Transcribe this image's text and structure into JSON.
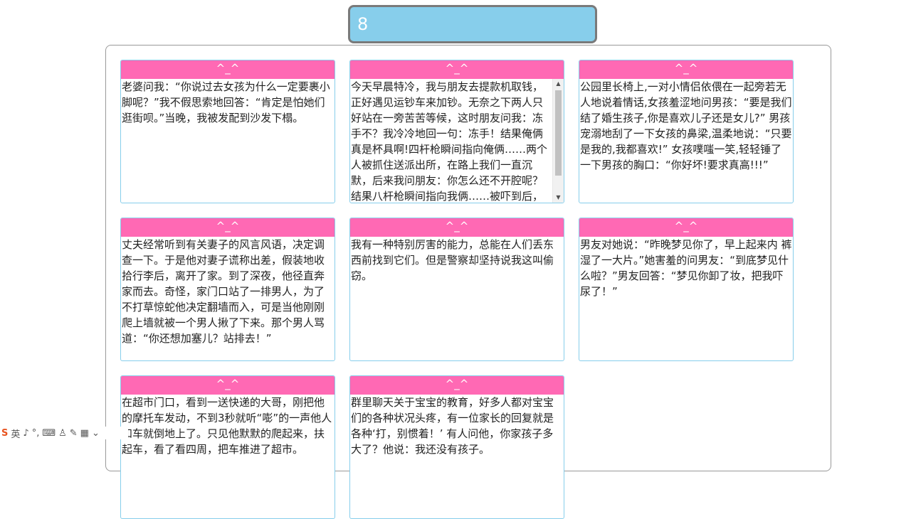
{
  "counter": {
    "value": "8"
  },
  "cards": [
    {
      "header": "^_^",
      "text": "老婆问我：“你说过去女孩为什么一定要裹小脚呢？”我不假思索地回答：“肯定是怕她们逛街呗。”当晚，我被发配到沙发下榻。"
    },
    {
      "header": "^_^",
      "text": "今天早晨特冷，我与朋友去提款机取钱，正好遇见运钞车来加钞。无奈之下两人只好站在一旁苦苦等候，这时朋友问我：冻手不？我冷冷地回一句：冻手！结果俺俩真是杯具啊!四杆枪瞬间指向俺俩……两个人被抓住送派出所，在路上我们一直沉默，后来我问朋友：你怎么还不开腔呢？结果八杆枪瞬间指向我俩……被吓到后，朋友终于开腔了："
    },
    {
      "header": "^_^",
      "text": "公园里长椅上,一对小情侣依偎在一起旁若无人地说着情话,女孩羞涩地问男孩：“要是我们结了婚生孩子,你是喜欢儿子还是女儿?” 男孩宠溺地刮了一下女孩的鼻梁,温柔地说：“只要是我的,我都喜欢!” 女孩噗嗤一笑,轻轻锤了一下男孩的胸口：“你好坏!要求真高!!!”"
    },
    {
      "header": "^_^",
      "text": "丈夫经常听到有关妻子的风言风语，决定调查一下。于是他对妻子谎称出差，假装地收拾行李后，离开了家。到了深夜，他径直奔家而去。奇怪，家门口站了一排男人，为了不打草惊蛇他决定翻墙而入，可是当他刚刚爬上墙就被一个男人揪了下来。那个男人骂道：“你还想加塞儿？站排去！”"
    },
    {
      "header": "^_^",
      "text": "我有一种特别厉害的能力，总能在人们丢东西前找到它们。但是警察却坚持说我这叫偷窃。"
    },
    {
      "header": "^_^",
      "text": "男友对她说：“昨晚梦见你了，早上起来内 裤湿了一大片。”她害羞的问男友：“到底梦见什么啦？”男友回答：“梦见你卸了妆，把我吓尿了！”"
    },
    {
      "header": "^_^",
      "text": "在超市门口，看到一送快递的大哥，刚把他的摩托车发动，不到3秒就听“嘭”的一声他人和车就倒地上了。只见他默默的爬起来，扶起车，看了看四周，把车推进了超市。"
    },
    {
      "header": "^_^",
      "text": "群里聊天关于宝宝的教育，好多人都对宝宝们的各种状况头疼，有一位家长的回复就是各种‘打，别惯着！’ 有人问他，你家孩子多大了？他说：我还没有孩子。"
    }
  ],
  "taskbar": {
    "logo": "S",
    "items": [
      "英",
      "♪",
      "°,",
      "⌨",
      "♙",
      "✎",
      "▦",
      "⌄"
    ]
  }
}
